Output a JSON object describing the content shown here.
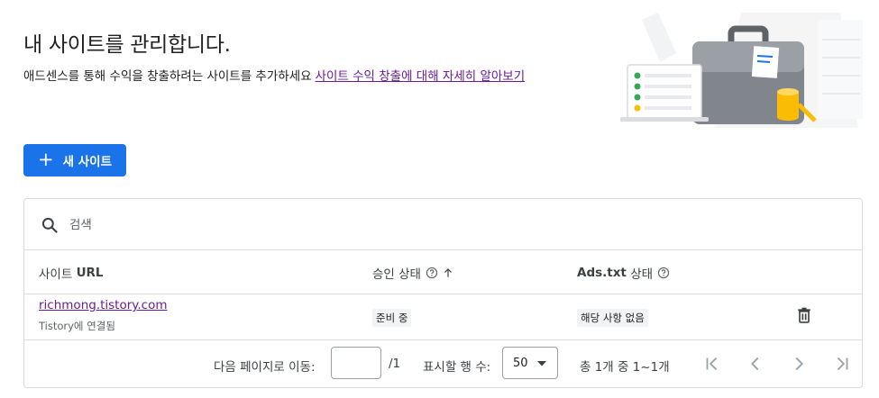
{
  "header": {
    "title": "내 사이트를 관리합니다.",
    "description": "애드센스를 통해 수익을 창출하려는 사이트를 추가하세요",
    "learn_more_link": "사이트 수익 창출에 대해 자세히 알아보기"
  },
  "toolbar": {
    "new_site_label": "새 사이트",
    "new_site_icon": "plus-icon"
  },
  "search": {
    "placeholder": "검색",
    "value": ""
  },
  "table": {
    "columns": [
      {
        "label_prefix": "사이트 ",
        "label_bold": "URL"
      },
      {
        "label": "승인 상태",
        "help_icon": "help-circle-icon",
        "sort_icon": "arrow-up-icon"
      },
      {
        "label_bold": "Ads.txt",
        "label_suffix": " 상태",
        "help_icon": "help-circle-icon"
      }
    ],
    "rows": [
      {
        "site_url": "richmong.tistory.com",
        "site_sub": "Tistory에 연결됨",
        "approval_status": "준비 중",
        "ads_txt_status": "해당 사항 없음",
        "delete_icon": "trash-icon"
      }
    ]
  },
  "pagination": {
    "goto_label": "다음 페이지로 이동:",
    "page_value": "",
    "total_pages": "/1",
    "rows_label": "표시할 행 수:",
    "rows_value": "50",
    "range_label": "총 1개 중 1~1개"
  },
  "colors": {
    "primary": "#1a73e8",
    "link_visited": "#6a1b9a",
    "border": "#dadce0"
  }
}
